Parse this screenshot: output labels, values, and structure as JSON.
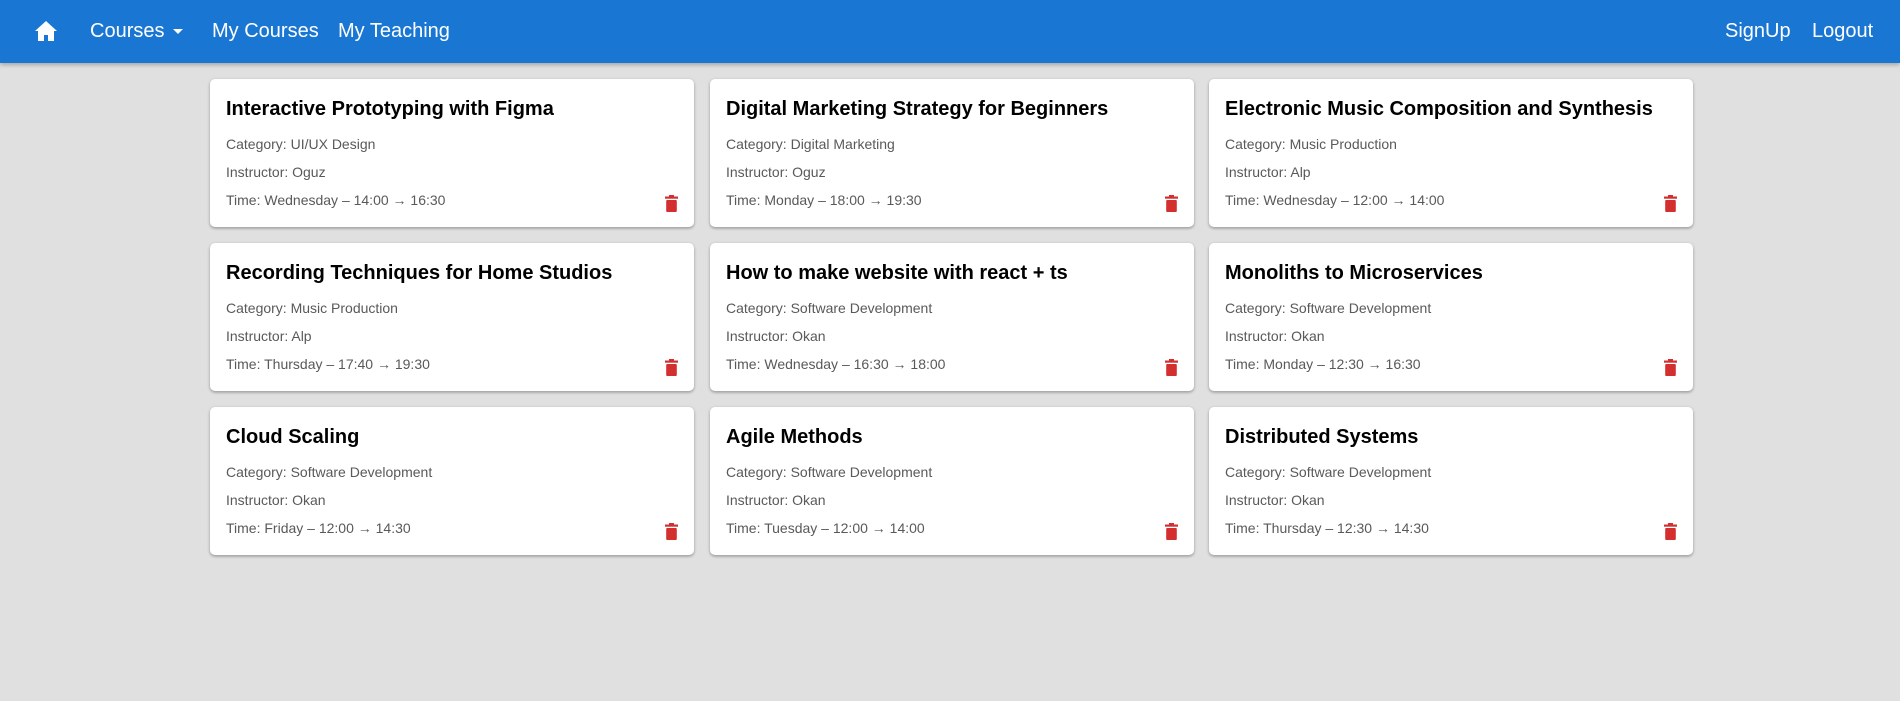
{
  "nav": {
    "home_icon": "home-icon",
    "courses_label": "Courses",
    "my_courses_label": "My Courses",
    "my_teaching_label": "My Teaching",
    "signup_label": "SignUp",
    "logout_label": "Logout"
  },
  "colors": {
    "navbar": "#1976d2",
    "background": "#e0e0e0",
    "delete_icon": "#d32f2f"
  },
  "courses": [
    {
      "title": "Interactive Prototyping with Figma",
      "category": "Category: UI/UX Design",
      "instructor": "Instructor: Oguz",
      "time": "Time: Wednesday – 14:00 → 16:30",
      "delete_icon": "trash-icon"
    },
    {
      "title": "Digital Marketing Strategy for Beginners",
      "category": "Category: Digital Marketing",
      "instructor": "Instructor: Oguz",
      "time": "Time: Monday – 18:00 → 19:30",
      "delete_icon": "trash-icon"
    },
    {
      "title": "Electronic Music Composition and Synthesis",
      "category": "Category: Music Production",
      "instructor": "Instructor: Alp",
      "time": "Time: Wednesday – 12:00 → 14:00",
      "delete_icon": "trash-icon"
    },
    {
      "title": "Recording Techniques for Home Studios",
      "category": "Category: Music Production",
      "instructor": "Instructor: Alp",
      "time": "Time: Thursday – 17:40 → 19:30",
      "delete_icon": "trash-icon"
    },
    {
      "title": "How to make website with react + ts",
      "category": "Category: Software Development",
      "instructor": "Instructor: Okan",
      "time": "Time: Wednesday – 16:30 → 18:00",
      "delete_icon": "trash-icon"
    },
    {
      "title": "Monoliths to Microservices",
      "category": "Category: Software Development",
      "instructor": "Instructor: Okan",
      "time": "Time: Monday – 12:30 → 16:30",
      "delete_icon": "trash-icon"
    },
    {
      "title": "Cloud Scaling",
      "category": "Category: Software Development",
      "instructor": "Instructor: Okan",
      "time": "Time: Friday – 12:00 → 14:30",
      "delete_icon": "trash-icon"
    },
    {
      "title": "Agile Methods",
      "category": "Category: Software Development",
      "instructor": "Instructor: Okan",
      "time": "Time: Tuesday – 12:00 → 14:00",
      "delete_icon": "trash-icon"
    },
    {
      "title": "Distributed Systems",
      "category": "Category: Software Development",
      "instructor": "Instructor: Okan",
      "time": "Time: Thursday – 12:30 → 14:30",
      "delete_icon": "trash-icon"
    }
  ]
}
